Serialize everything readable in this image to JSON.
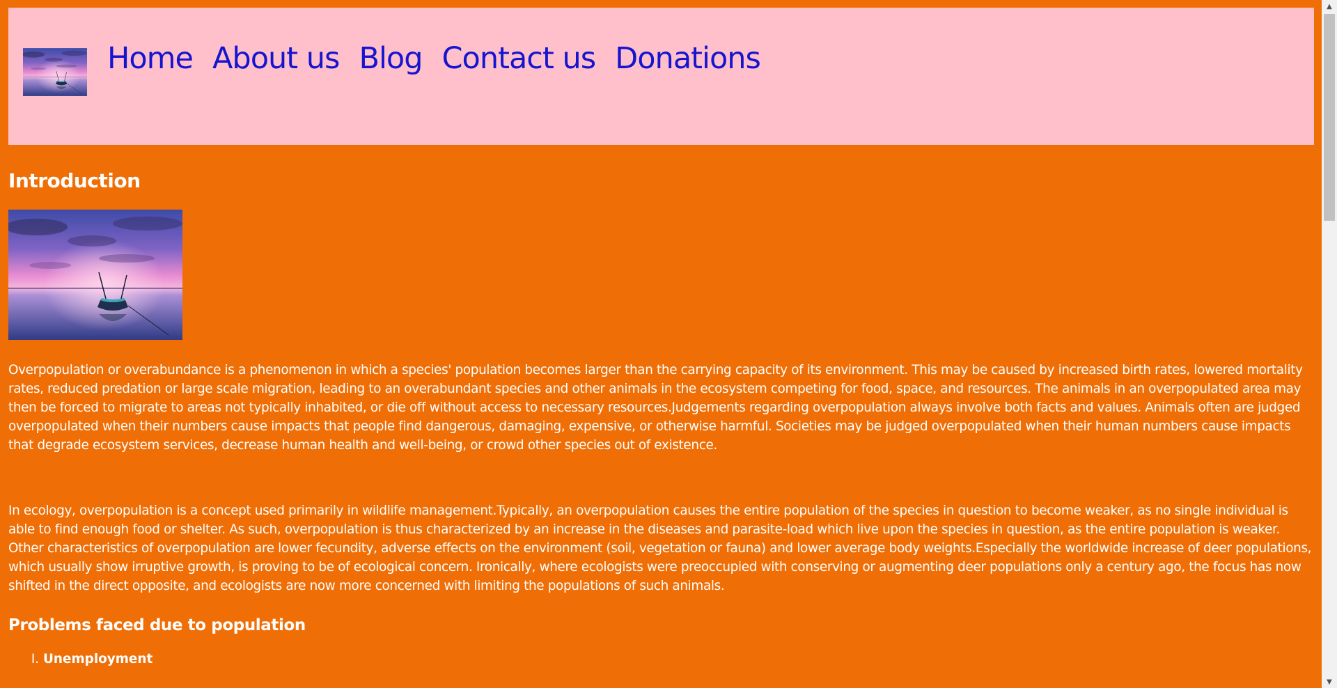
{
  "nav": {
    "logo_alt": "logo",
    "items": [
      {
        "label": "Home"
      },
      {
        "label": "About us"
      },
      {
        "label": "Blog"
      },
      {
        "label": "Contact us"
      },
      {
        "label": "Donations"
      }
    ]
  },
  "main": {
    "intro_heading": "Introduction",
    "hero_alt": "boat at sunset",
    "paragraph_1": "Overpopulation or overabundance is a phenomenon in which a species' population becomes larger than the carrying capacity of its environment. This may be caused by increased birth rates, lowered mortality rates, reduced predation or large scale migration, leading to an overabundant species and other animals in the ecosystem competing for food, space, and resources. The animals in an overpopulated area may then be forced to migrate to areas not typically inhabited, or die off without access to necessary resources.Judgements regarding overpopulation always involve both facts and values. Animals often are judged overpopulated when their numbers cause impacts that people find dangerous, damaging, expensive, or otherwise harmful. Societies may be judged overpopulated when their human numbers cause impacts that degrade ecosystem services, decrease human health and well-being, or crowd other species out of existence.",
    "paragraph_2": "In ecology, overpopulation is a concept used primarily in wildlife management.Typically, an overpopulation causes the entire population of the species in question to become weaker, as no single individual is able to find enough food or shelter. As such, overpopulation is thus characterized by an increase in the diseases and parasite-load which live upon the species in question, as the entire population is weaker. Other characteristics of overpopulation are lower fecundity, adverse effects on the environment (soil, vegetation or fauna) and lower average body weights.Especially the worldwide increase of deer populations, which usually show irruptive growth, is proving to be of ecological concern. Ironically, where ecologists were preoccupied with conserving or augmenting deer populations only a century ago, the focus has now shifted in the direct opposite, and ecologists are now more concerned with limiting the populations of such animals.",
    "problems_heading": "Problems faced due to population",
    "problems": [
      "Unemployment"
    ]
  },
  "colors": {
    "page_background": "#f06e06",
    "header_background": "#ffc0cb",
    "nav_link": "#1515d0",
    "text": "#ffffff"
  },
  "scrollbar": {
    "up_icon": "triangle-up-icon",
    "down_icon": "triangle-down-icon"
  }
}
